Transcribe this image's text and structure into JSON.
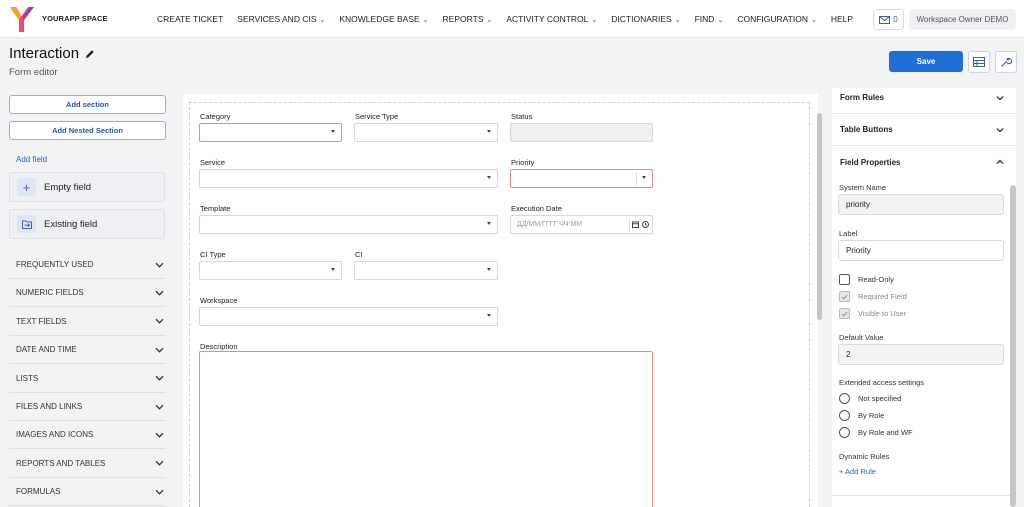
{
  "app": {
    "brand": "YOURAPP SPACE",
    "nav": [
      {
        "label": "CREATE TICKET",
        "dropdown": false
      },
      {
        "label": "SERVICES AND CIS",
        "dropdown": true
      },
      {
        "label": "KNOWLEDGE BASE",
        "dropdown": true
      },
      {
        "label": "REPORTS",
        "dropdown": true
      },
      {
        "label": "ACTIVITY CONTROL",
        "dropdown": true
      },
      {
        "label": "DICTIONARIES",
        "dropdown": true
      },
      {
        "label": "FIND",
        "dropdown": true
      },
      {
        "label": "CONFIGURATION",
        "dropdown": true
      },
      {
        "label": "HELP",
        "dropdown": false
      }
    ],
    "mail_count": "0",
    "workspace": "Workspace Owner DEMO",
    "colors": {
      "accent": "#1f6fd8",
      "required_border": "#e68a82",
      "link": "#1f63c8"
    }
  },
  "header": {
    "title": "Interaction",
    "subtitle": "Form editor",
    "save_label": "Save"
  },
  "left_panel": {
    "add_section": "Add section",
    "add_nested_section": "Add Nested Section",
    "add_field": "Add field",
    "empty_field": "Empty field",
    "existing_field": "Existing field",
    "categories": [
      "FREQUENTLY USED",
      "NUMERIC FIELDS",
      "TEXT FIELDS",
      "DATE AND TIME",
      "LISTS",
      "FILES AND LINKS",
      "IMAGES AND ICONS",
      "REPORTS AND TABLES",
      "FORMULAS"
    ]
  },
  "form": {
    "category": "Category",
    "service_type": "Service Type",
    "status": "Status",
    "service": "Service",
    "priority": "Priority",
    "template": "Template",
    "execution_date": "Execution Date",
    "execution_date_placeholder": "ДД/ММ/ГГГГ ЧЧ:ММ",
    "ci_type": "CI Type",
    "ci": "CI",
    "workspace": "Workspace",
    "description": "Description"
  },
  "right_panel": {
    "form_rules": "Form Rules",
    "table_buttons": "Table Buttons",
    "field_properties": "Field Properties",
    "system_name_label": "System Name",
    "system_name_value": "priority",
    "label_label": "Label",
    "label_value": "Priority",
    "read_only": "Read-Only",
    "required_field": "Required Field",
    "visible_to_user": "Visible to User",
    "default_value_label": "Default Value",
    "default_value": "2",
    "extended_access": "Extended access settings",
    "access_options": [
      "Not specified",
      "By Role",
      "By Role and WF"
    ],
    "dynamic_rules": "Dynamic Rules",
    "add_rule": "+ Add Rule"
  }
}
